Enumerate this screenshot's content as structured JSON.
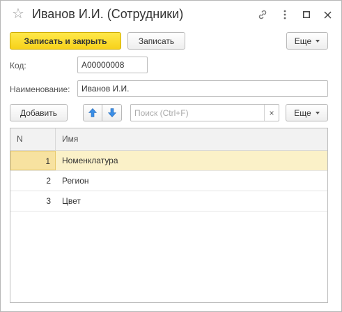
{
  "window": {
    "title": "Иванов И.И. (Сотрудники)",
    "accent_color": "#f9d92f"
  },
  "toolbar": {
    "save_close_label": "Записать и закрыть",
    "save_label": "Записать",
    "more_label": "Еще"
  },
  "form": {
    "code_label": "Код:",
    "code_value": "А00000008",
    "name_label": "Наименование:",
    "name_value": "Иванов И.И."
  },
  "table_toolbar": {
    "add_label": "Добавить",
    "search_placeholder": "Поиск (Ctrl+F)",
    "clear_symbol": "×",
    "more_label": "Еще"
  },
  "table": {
    "columns": [
      "N",
      "Имя"
    ],
    "rows": [
      {
        "n": "1",
        "name": "Номенклатура"
      },
      {
        "n": "2",
        "name": "Регион"
      },
      {
        "n": "3",
        "name": "Цвет"
      }
    ]
  }
}
